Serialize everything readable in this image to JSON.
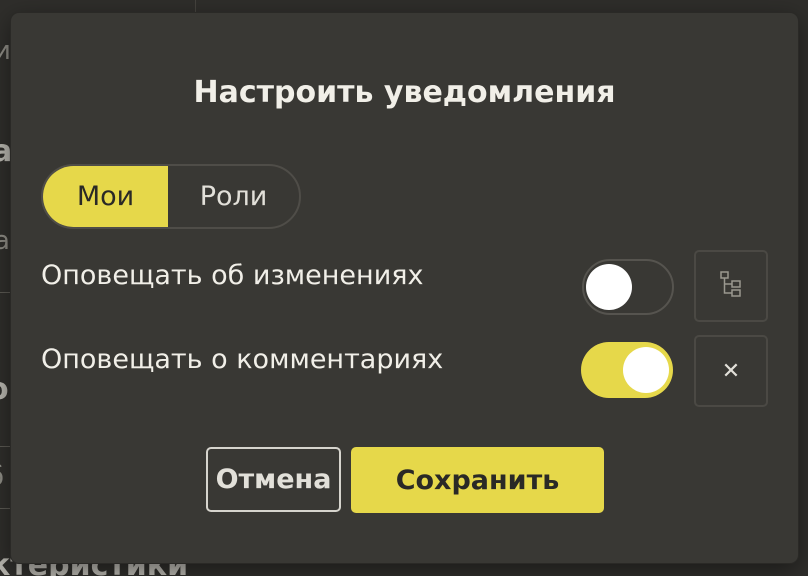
{
  "background": {
    "fragments": [
      "и",
      "а",
      "а",
      "о",
      "б",
      "ктеристики"
    ]
  },
  "dialog": {
    "title": "Настроить уведомления",
    "segmented": {
      "options": [
        "Мои",
        "Роли"
      ],
      "selected": "Мои"
    },
    "settings": [
      {
        "label": "Оповещать об изменениях",
        "enabled": false,
        "action_icon": "tree-structure-icon"
      },
      {
        "label": "Оповещать о комментариях",
        "enabled": true,
        "action_icon": "close-icon",
        "action_glyph": "✕"
      }
    ],
    "buttons": {
      "cancel": "Отмена",
      "save": "Сохранить"
    }
  },
  "colors": {
    "accent": "#e6d84a",
    "dialog_bg": "#393834",
    "page_bg": "#2e2d2a",
    "text": "#f1efe8"
  }
}
